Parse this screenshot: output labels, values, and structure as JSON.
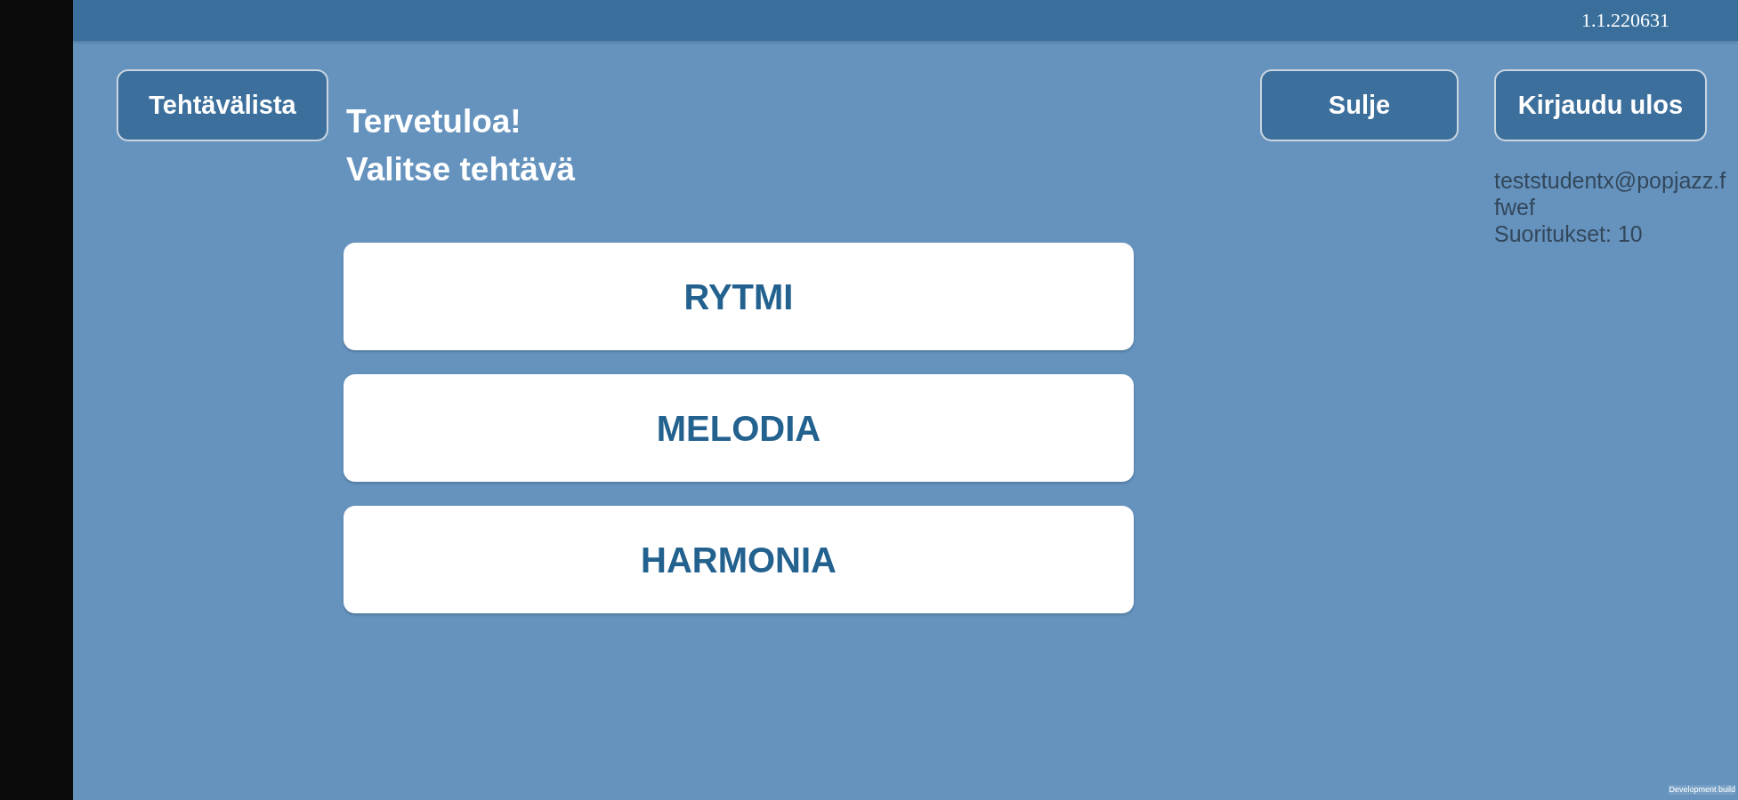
{
  "top_bar": {
    "version": "1.1.220631"
  },
  "header": {
    "task_list_button": "Tehtävälista",
    "greeting": "Tervetuloa!",
    "instruction": "Valitse tehtävä",
    "close_button": "Sulje",
    "logout_button": "Kirjaudu ulos"
  },
  "user_info": [
    "teststudentx@popjazz.f",
    "fwef",
    "Suoritukset: 10"
  ],
  "task_categories": [
    {
      "label": "RYTMI"
    },
    {
      "label": "MELODIA"
    },
    {
      "label": "HARMONIA"
    }
  ],
  "build_label": "Development build"
}
